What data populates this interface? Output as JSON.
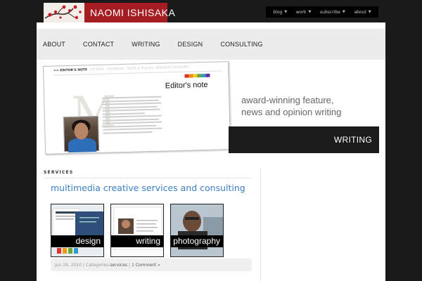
{
  "site": {
    "logo_first": "NAOMI",
    "logo_last": "ISHISAKA"
  },
  "topnav": [
    {
      "label": "blog"
    },
    {
      "label": "work"
    },
    {
      "label": "subscribe"
    },
    {
      "label": "about"
    }
  ],
  "mainnav": [
    {
      "label": "ABOUT"
    },
    {
      "label": "CONTACT"
    },
    {
      "label": "WRITING"
    },
    {
      "label": "DESIGN"
    },
    {
      "label": "CONSULTING"
    }
  ],
  "banner": {
    "mag_tabs": [
      ">> EDITOR'S NOTE",
      "LETTERS",
      "CALENDAR",
      "FACES & PLACES",
      "BORDERS CROSSING"
    ],
    "mag_title": "Editor's note",
    "mag_dropcap": "M",
    "tagline_line1": "award-winning feature,",
    "tagline_line2": "news and opinion writing",
    "bar_label": "WRITING"
  },
  "content": {
    "section_label": "SERVICES",
    "post_title": "multimedia creative services and consulting",
    "thumbs": [
      {
        "label": "design"
      },
      {
        "label": "writing"
      },
      {
        "label": "photography"
      }
    ],
    "meta": {
      "date": "Jun 28, 2010",
      "categories_prefix": "Categories:",
      "category": "services",
      "comments": "1 Comment »"
    }
  },
  "colors": {
    "logo_bg": "#a51c22",
    "link_blue": "#3d80c4",
    "nav_bg": "#ececec"
  }
}
